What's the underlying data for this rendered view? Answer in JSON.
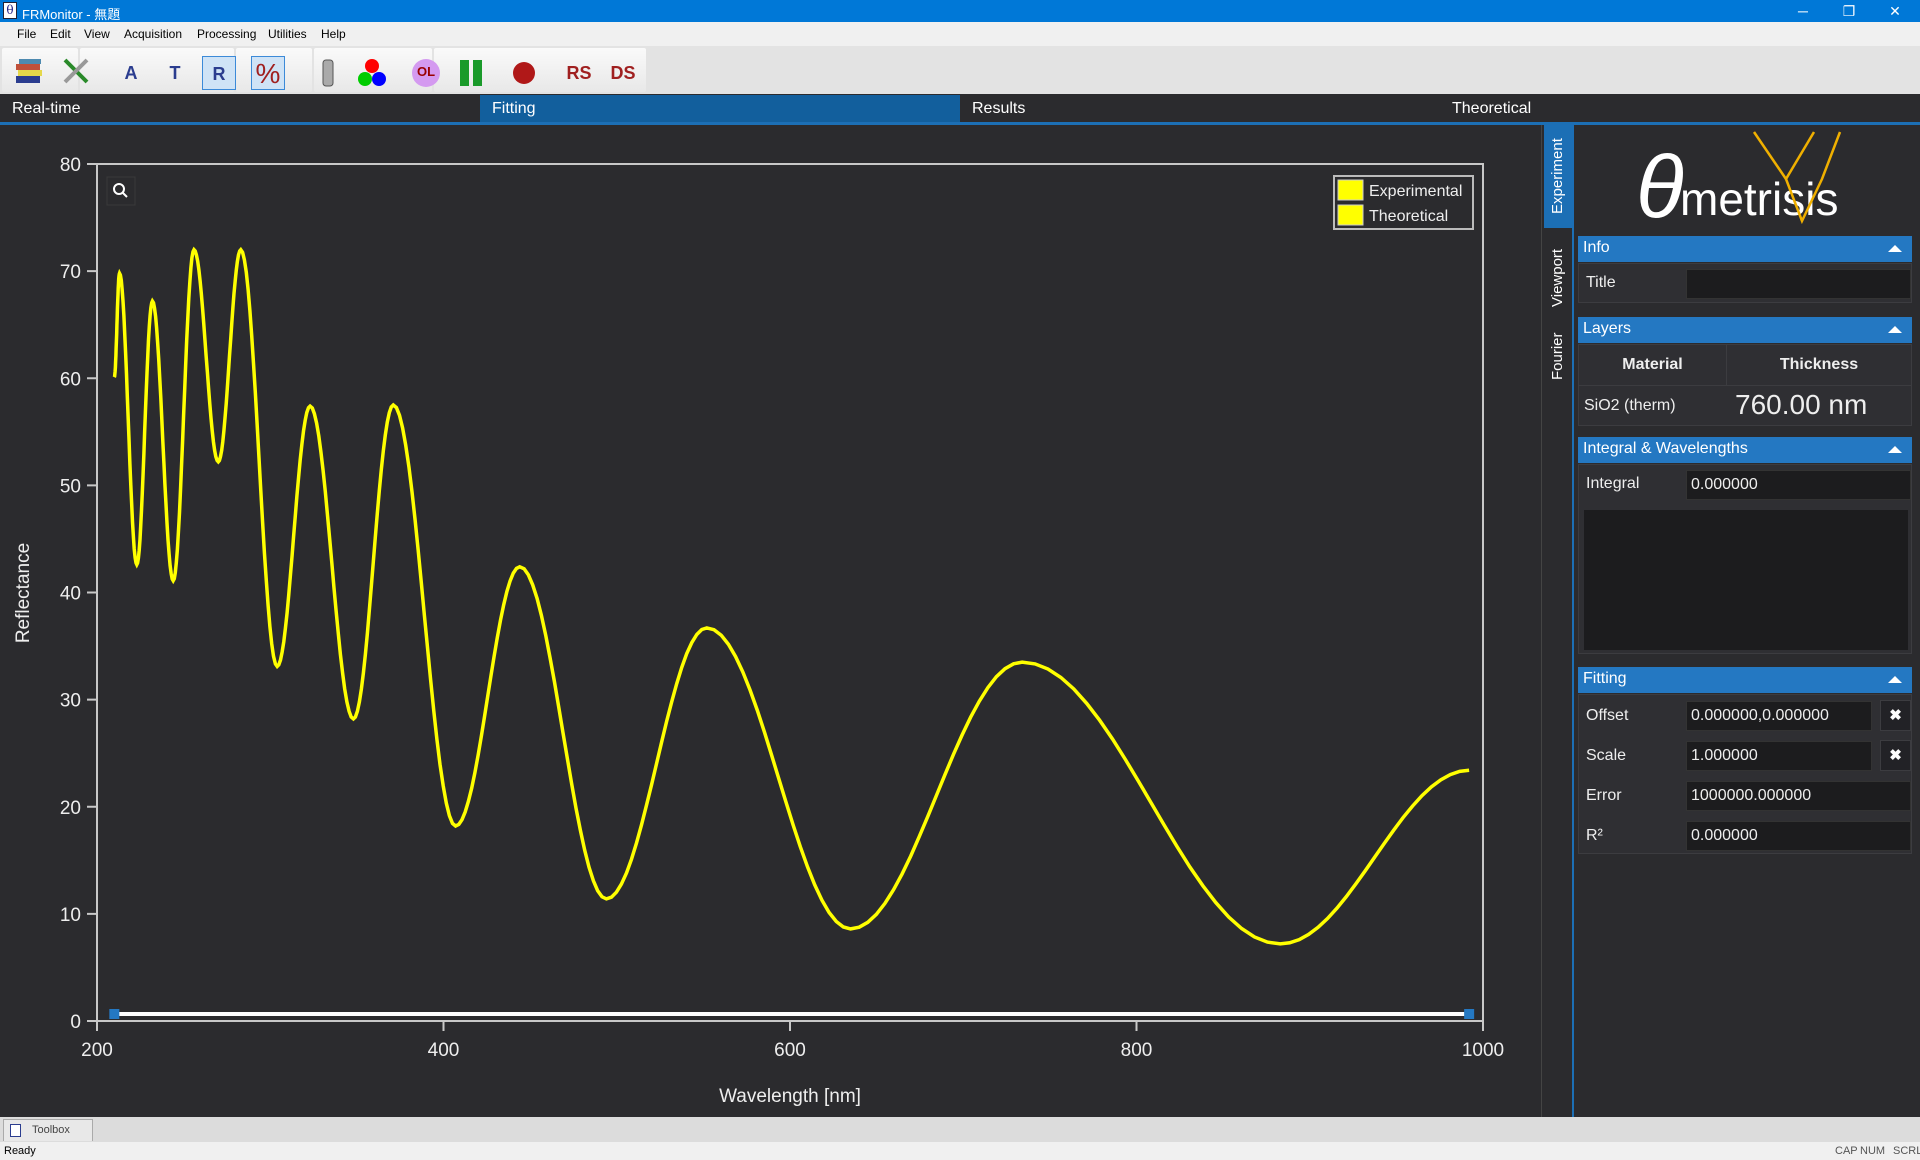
{
  "window": {
    "title": "FRMonitor - 無題",
    "icon": "app-theta-icon",
    "minimize": "─",
    "restore": "❐",
    "close": "✕"
  },
  "menu": [
    "File",
    "Edit",
    "View",
    "Acquisition",
    "Processing",
    "Utilities",
    "Help"
  ],
  "toolbar": {
    "a": "A",
    "t": "T",
    "r": "R",
    "percent": "%",
    "ol": "OL",
    "rs": "RS",
    "ds": "DS",
    "active": [
      "R",
      "%"
    ]
  },
  "tabs": [
    {
      "label": "Real-time"
    },
    {
      "label": "Fitting",
      "active": true
    },
    {
      "label": "Results"
    },
    {
      "label": "Theoretical"
    }
  ],
  "vtabs": [
    {
      "label": "Experiment",
      "active": true
    },
    {
      "label": "Viewport"
    },
    {
      "label": "Fourier"
    }
  ],
  "logo": {
    "text": "θmetrisis"
  },
  "panel": {
    "info": {
      "header": "Info",
      "title_label": "Title",
      "title_value": ""
    },
    "layers": {
      "header": "Layers",
      "col_material": "Material",
      "col_thickness": "Thickness",
      "rows": [
        {
          "material": "SiO2 (therm)",
          "thickness": "760.00 nm"
        }
      ]
    },
    "integral": {
      "header": "Integral & Wavelengths",
      "integral_label": "Integral",
      "integral_value": "0.000000"
    },
    "fitting": {
      "header": "Fitting",
      "offset_label": "Offset",
      "offset_value": "0.000000,0.000000",
      "scale_label": "Scale",
      "scale_value": "1.000000",
      "error_label": "Error",
      "error_value": "1000000.000000",
      "r2_label": "R²",
      "r2_value": "0.000000",
      "clear": "✖"
    }
  },
  "bottom": {
    "toolbox": "Toolbox",
    "status": "Ready",
    "cap": "CAP",
    "num": "NUM",
    "scrl": "SCRL"
  },
  "colors": {
    "accent": "#2478c2",
    "curve": "#ffff00",
    "background": "#2b2b2e"
  },
  "chart_data": {
    "type": "line",
    "xlabel": "Wavelength [nm]",
    "ylabel": "Reflectance",
    "xlim": [
      200,
      1000
    ],
    "ylim": [
      0,
      80
    ],
    "xticks": [
      200,
      400,
      600,
      800,
      1000
    ],
    "yticks": [
      0,
      10,
      20,
      30,
      40,
      50,
      60,
      70,
      80
    ],
    "legend": {
      "placement": "top-right",
      "entries": [
        "Experimental",
        "Theoretical"
      ]
    },
    "grid": false,
    "series": [
      {
        "name": "Theoretical",
        "color": "#ffff00",
        "points": [
          [
            210,
            60.1
          ],
          [
            213,
            69.8
          ],
          [
            223,
            42.6
          ],
          [
            232,
            67.2
          ],
          [
            244,
            41.1
          ],
          [
            256,
            72.0
          ],
          [
            270,
            52.2
          ],
          [
            283,
            72.0
          ],
          [
            304,
            33.1
          ],
          [
            323,
            57.4
          ],
          [
            348,
            28.2
          ],
          [
            371,
            57.5
          ],
          [
            407,
            18.2
          ],
          [
            444,
            42.4
          ],
          [
            494,
            11.4
          ],
          [
            552,
            36.7
          ],
          [
            635,
            8.6
          ],
          [
            734,
            33.5
          ],
          [
            883,
            7.2
          ],
          [
            992,
            23.4
          ]
        ]
      }
    ],
    "range": [
      210,
      992
    ]
  }
}
